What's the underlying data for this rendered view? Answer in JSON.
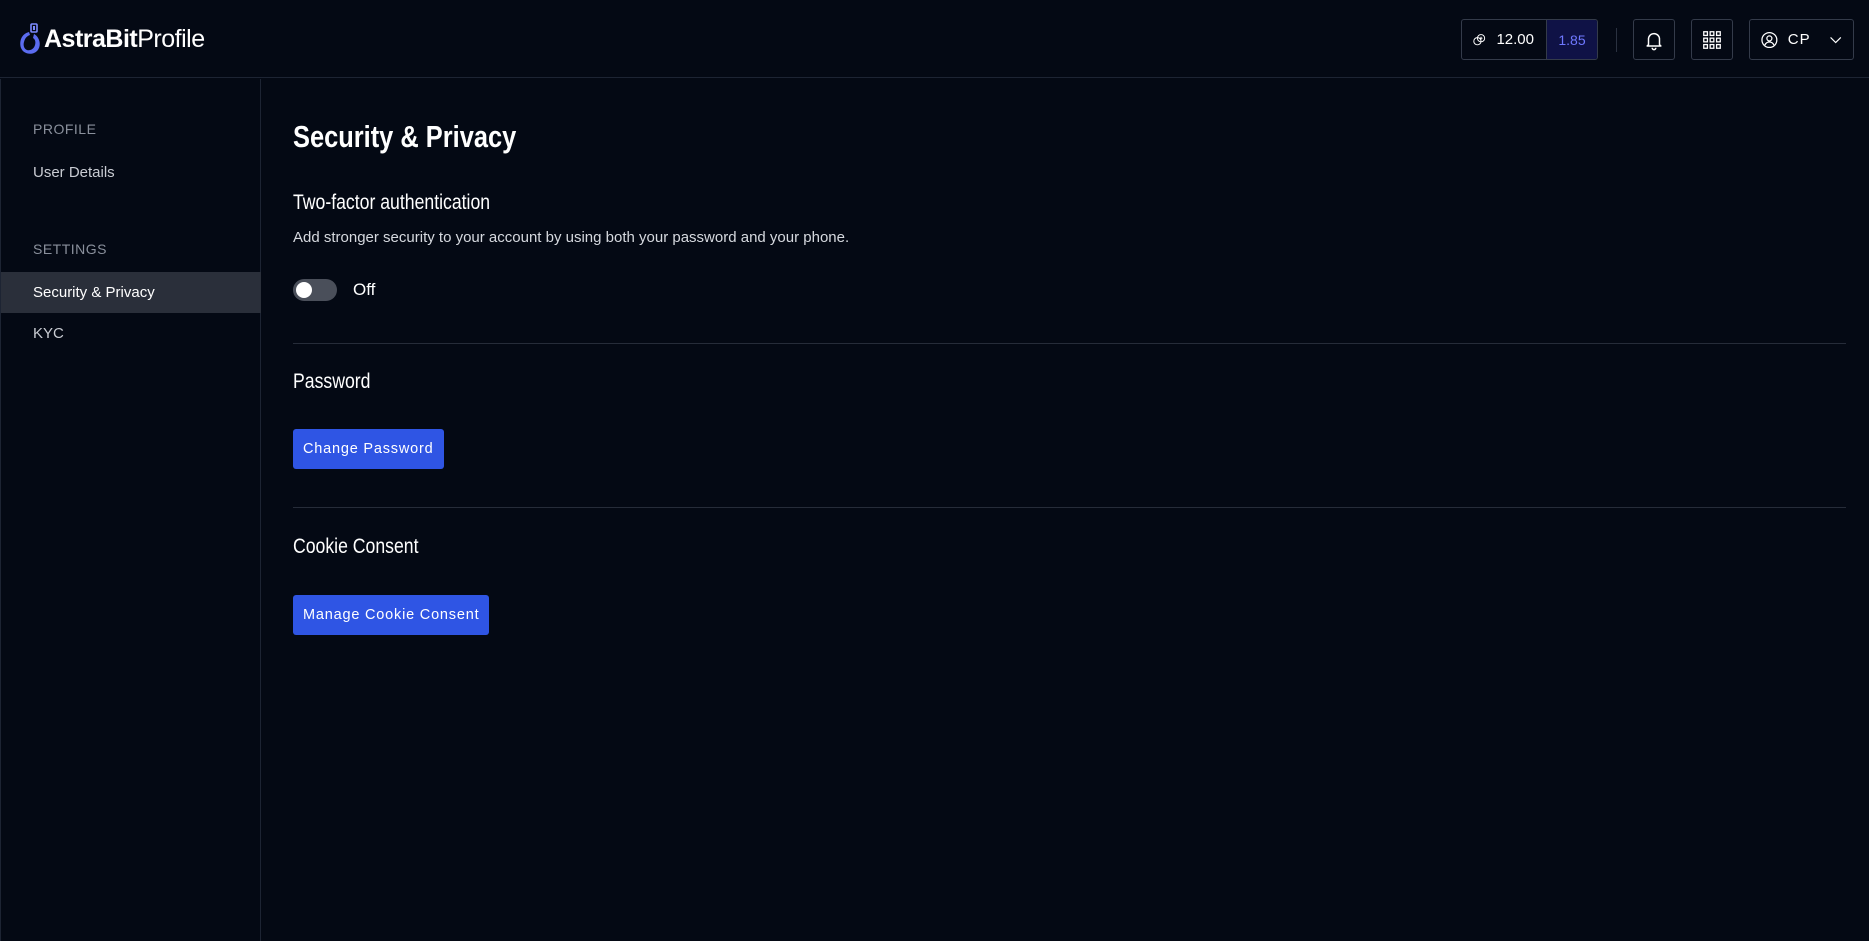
{
  "header": {
    "logo_brand": "AstraBit",
    "logo_suffix": "Profile",
    "balance_main": "12.00",
    "balance_secondary": "1.85",
    "user_initials": "CP"
  },
  "sidebar": {
    "sections": [
      {
        "label": "PROFILE",
        "items": [
          {
            "label": "User Details",
            "active": false
          }
        ]
      },
      {
        "label": "SETTINGS",
        "items": [
          {
            "label": "Security & Privacy",
            "active": true
          },
          {
            "label": "KYC",
            "active": false
          }
        ]
      }
    ]
  },
  "main": {
    "title": "Security & Privacy",
    "two_factor": {
      "title": "Two-factor authentication",
      "description": "Add stronger security to your account by using both your password and your phone.",
      "toggle_state": "Off",
      "enabled": false
    },
    "password": {
      "title": "Password",
      "button_label": "Change Password"
    },
    "cookie": {
      "title": "Cookie Consent",
      "button_label": "Manage Cookie Consent"
    }
  },
  "colors": {
    "background": "#040914",
    "accent": "#2f55e4",
    "active_item": "#2a2f3a",
    "secondary_balance_bg": "#0f1246",
    "secondary_balance_text": "#6f78ff"
  },
  "icons": [
    "logo-icon",
    "coin-icon",
    "bell-icon",
    "apps-grid-icon",
    "user-icon",
    "chevron-down-icon"
  ]
}
